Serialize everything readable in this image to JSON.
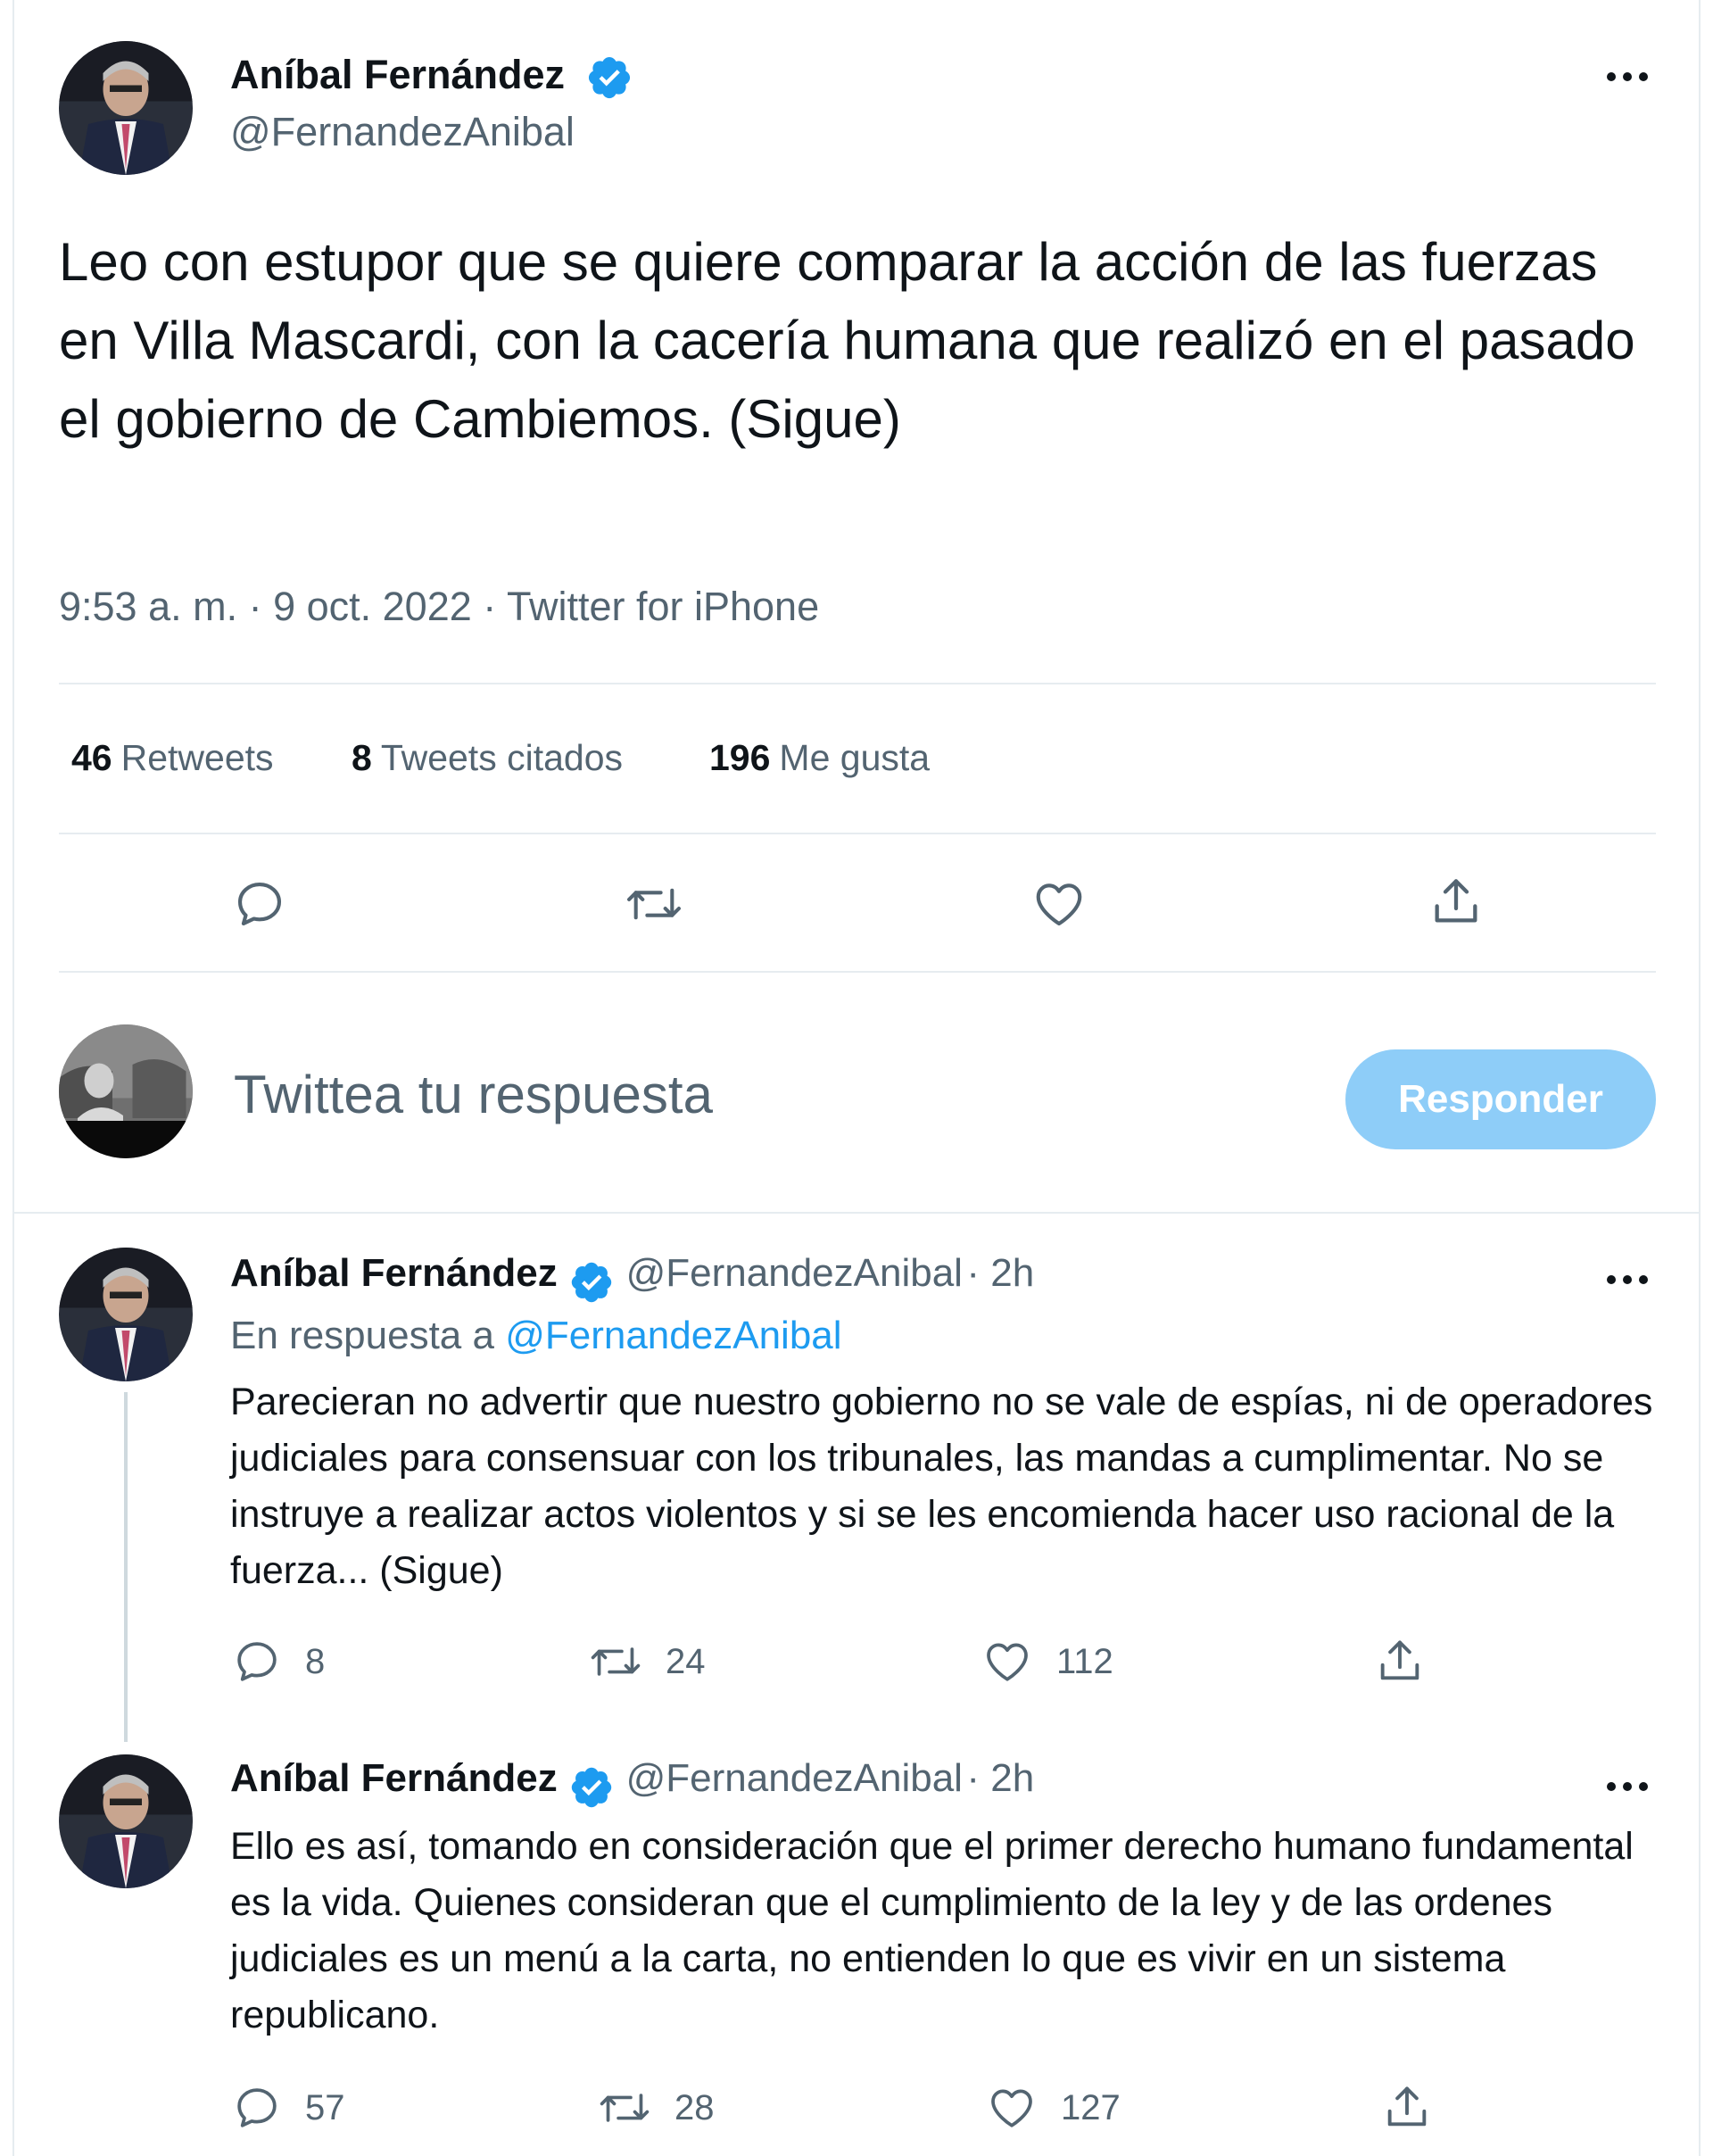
{
  "main_tweet": {
    "author_name": "Aníbal Fernández",
    "handle": "@FernandezAnibal",
    "text": "Leo con estupor que se quiere comparar la acción de las fuerzas en Villa Mascardi, con la cacería humana que realizó en el pasado el gobierno de Cambiemos. (Sigue)",
    "timestamp": "9:53 a. m. · 9 oct. 2022 · Twitter for iPhone",
    "stats": {
      "retweets": "46",
      "retweets_label": "Retweets",
      "quotes": "8",
      "quotes_label": "Tweets citados",
      "likes": "196",
      "likes_label": "Me gusta"
    }
  },
  "reply_box": {
    "placeholder": "Twittea tu respuesta",
    "button_label": "Responder"
  },
  "replies": [
    {
      "author_name": "Aníbal Fernández",
      "handle": "@FernandezAnibal",
      "time": "· 2h",
      "in_reply_prefix": "En respuesta a",
      "in_reply_handle": "@FernandezAnibal",
      "text": "Parecieran no advertir que nuestro gobierno no se vale de espías, ni de operadores judiciales para consensuar con los tribunales, las mandas a cumplimentar. No se instruye a realizar actos violentos y si se les encomienda hacer uso racional de la fuerza... (Sigue)",
      "replies": "8",
      "retweets": "24",
      "likes": "112"
    },
    {
      "author_name": "Aníbal Fernández",
      "handle": "@FernandezAnibal",
      "time": "· 2h",
      "text": "Ello es así, tomando en consideración que el primer derecho humano fundamental es la vida. Quienes consideran que el cumplimiento de la ley y de las ordenes judiciales es un menú a la carta, no entienden lo que es vivir en un sistema republicano.",
      "replies": "57",
      "retweets": "28",
      "likes": "127"
    }
  ],
  "colors": {
    "text_primary": "#0f1419",
    "text_secondary": "#536471",
    "link": "#1d9bf0",
    "verified": "#1d9bf0",
    "button_disabled": "#8ecdf8",
    "divider": "#e6ecf0"
  },
  "icons": [
    "verified-badge-icon",
    "more-icon",
    "reply-icon",
    "retweet-icon",
    "like-icon",
    "share-icon"
  ]
}
